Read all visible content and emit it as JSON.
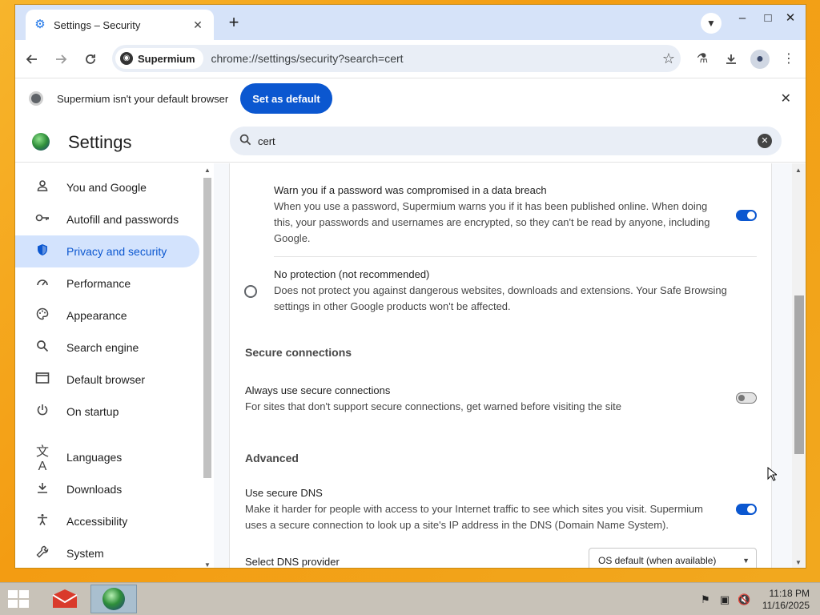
{
  "browser": {
    "tab_title": "Settings – Security",
    "tab_close": "✕",
    "new_tab": "+",
    "site_chip": "Supermium",
    "url": "chrome://settings/security?search=cert",
    "window_controls": {
      "minimize": "–",
      "maximize": "□",
      "close": "✕"
    }
  },
  "banner": {
    "message": "Supermium isn't your default browser",
    "button": "Set as default",
    "close": "✕"
  },
  "settings": {
    "title": "Settings",
    "search_value": "cert",
    "search_clear": "✕"
  },
  "sidebar": {
    "items": [
      {
        "label": "You and Google",
        "icon": "person-icon"
      },
      {
        "label": "Autofill and passwords",
        "icon": "key-icon"
      },
      {
        "label": "Privacy and security",
        "icon": "shield-icon"
      },
      {
        "label": "Performance",
        "icon": "speedometer-icon"
      },
      {
        "label": "Appearance",
        "icon": "palette-icon"
      },
      {
        "label": "Search engine",
        "icon": "search-icon"
      },
      {
        "label": "Default browser",
        "icon": "browser-icon"
      },
      {
        "label": "On startup",
        "icon": "power-icon"
      },
      {
        "label": "Languages",
        "icon": "translate-icon"
      },
      {
        "label": "Downloads",
        "icon": "download-icon"
      },
      {
        "label": "Accessibility",
        "icon": "accessibility-icon"
      },
      {
        "label": "System",
        "icon": "wrench-icon"
      }
    ],
    "active_index": 2
  },
  "content": {
    "breach": {
      "title": "Warn you if a password was compromised in a data breach",
      "line1": "When you use a password, Supermium warns you if it has been published online. When doing",
      "line2": "this, your passwords and usernames are encrypted, so they can't be read by anyone, including",
      "line3": "Google.",
      "enabled": true
    },
    "no_protection": {
      "title": "No protection (not recommended)",
      "line1": "Does not protect you against dangerous websites, downloads and extensions. Your Safe Browsing",
      "line2": "settings in other Google products won't be affected.",
      "selected": false
    },
    "secure_connections_heading": "Secure connections",
    "always_secure": {
      "title": "Always use secure connections",
      "desc": "For sites that don't support secure connections, get warned before visiting the site",
      "enabled": false
    },
    "advanced_heading": "Advanced",
    "secure_dns": {
      "title": "Use secure DNS",
      "line1": "Make it harder for people with access to your Internet traffic to see which sites you visit. Supermium",
      "line2": "uses a secure connection to look up a site's IP address in the DNS (Domain Name System).",
      "enabled": true
    },
    "dns_provider": {
      "label": "Select DNS provider",
      "value": "OS default (when available)"
    }
  },
  "taskbar": {
    "time": "11:18 PM",
    "date": "11/16/2025"
  },
  "colors": {
    "accent": "#0b57d0",
    "sidebar_active_bg": "#d3e3fd",
    "tab_strip": "#d6e3f9"
  }
}
